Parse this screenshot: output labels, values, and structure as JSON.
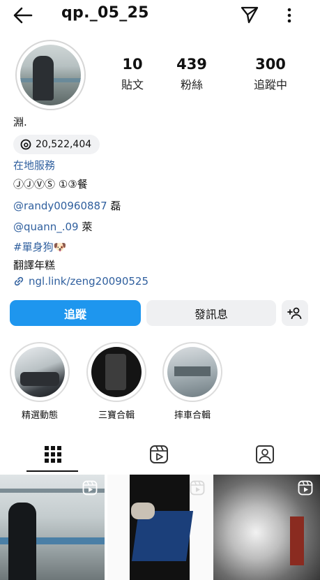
{
  "profile": {
    "username": "qp._05_25",
    "display_name": "淵.",
    "threads_count": "20,522,404",
    "category": "在地服務",
    "bio_lines": [
      "ⒿⒿⓋⓈ ①③餐"
    ],
    "mentions": [
      {
        "handle": "@randy00960887",
        "suffix": "磊"
      },
      {
        "handle": "@quann_.09",
        "suffix": "萊"
      }
    ],
    "hashtag": "#單身狗",
    "hashtag_emoji": "🐶",
    "bio_last": "翻譯年糕",
    "link": "ngl.link/zeng20090525"
  },
  "stats": [
    {
      "value": "10",
      "label": "貼文"
    },
    {
      "value": "439",
      "label": "粉絲"
    },
    {
      "value": "300",
      "label": "追蹤中"
    }
  ],
  "actions": {
    "follow": "追蹤",
    "message": "發訊息"
  },
  "highlights": [
    {
      "label": "精選動態"
    },
    {
      "label": "三寶合輯"
    },
    {
      "label": "摔車合輯"
    }
  ],
  "tabs": [
    "grid-icon",
    "reels-icon",
    "tagged-icon"
  ],
  "colors": {
    "accent": "#1e96ee",
    "link": "#2f5f9e"
  }
}
